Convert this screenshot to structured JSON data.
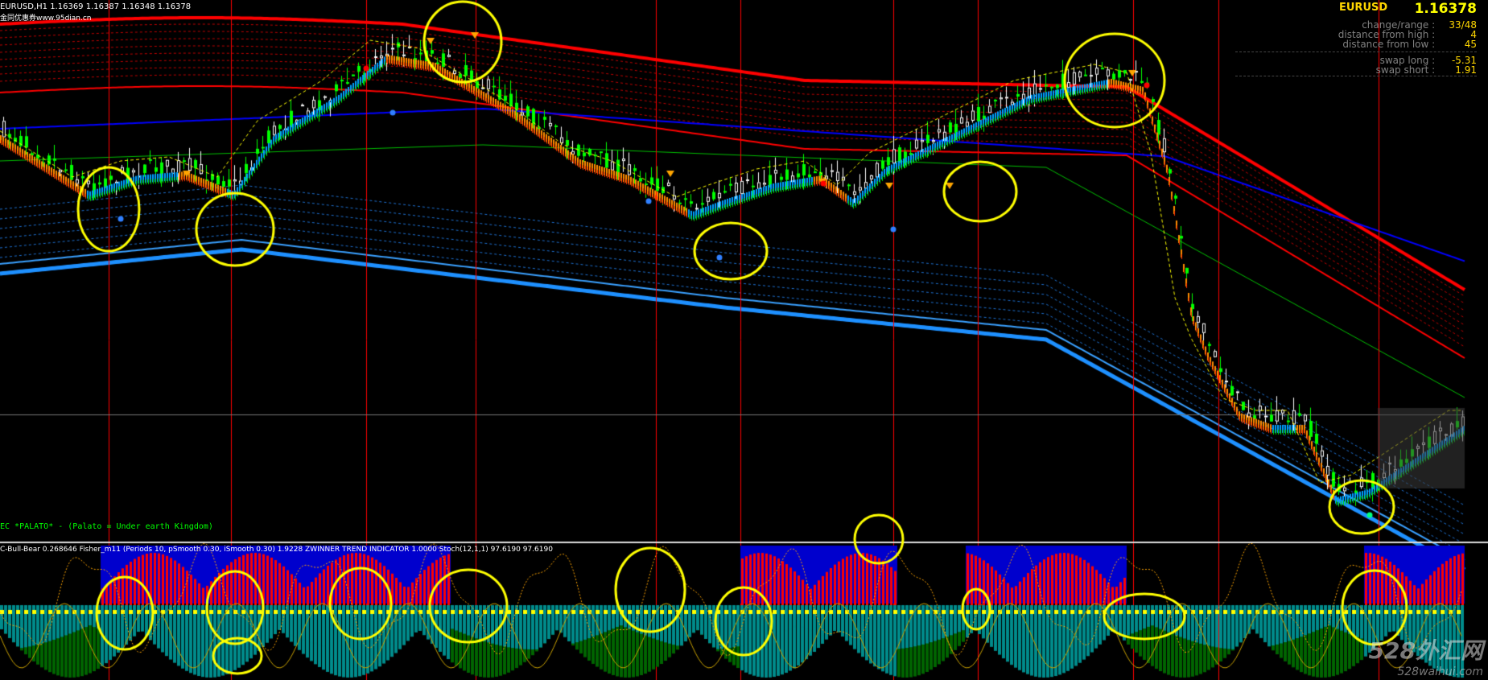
{
  "window": {
    "symbol_header": "EURUSD,H1  1.16369 1.16387 1.16348 1.16378",
    "source_watermark": "金同优惠券www.95dian.cn",
    "indicator_comment": "EC *PALATO* - (Palato = Under earth Kingdom)",
    "sub_window_header": "C-Bull-Bear 0.268646  Fisher_m11  (Periods 10, pSmooth 0.30, iSmooth 0.30)  1.9228  ZWINNER TREND INDICATOR 1.0000  Stoch(12,1,1) 97.6190 97.6190",
    "corner_watermark": "528外汇网",
    "corner_watermark_url": "528waihui.com"
  },
  "info_panel": {
    "symbol": "EURUSD",
    "price": "1.16378",
    "rows": [
      {
        "label": "change/range :",
        "value": "33/48"
      },
      {
        "label": "distance from high :",
        "value": "4"
      },
      {
        "label": "distance from low :",
        "value": "45"
      },
      {
        "label": "swap long :",
        "value": "-5.31"
      },
      {
        "label": "swap short :",
        "value": "1.91"
      }
    ]
  },
  "colors": {
    "background": "#000000",
    "bull_candle": "#00FF00",
    "bear_candle": "#FFFFFF",
    "upper_band": "#FF0000",
    "lower_band": "#1E90FF",
    "ma_blue": "#0000FF",
    "trend_orange": "#FF8C00",
    "signal_yellow": "#FFFF00",
    "session_line": "#FF0000",
    "histogram_blue": "#0000CD",
    "histogram_red": "#FF0000",
    "histogram_teal": "#008B8B",
    "histogram_green": "#006400",
    "annotation_circle": "#FFFF00"
  },
  "chart_data": {
    "type": "candlestick",
    "symbol": "EURUSD",
    "timeframe": "H1",
    "ohlc_last": {
      "open": 1.16369,
      "high": 1.16387,
      "low": 1.16348,
      "close": 1.16378
    },
    "close_series": [
      1.1712,
      1.1708,
      1.1703,
      1.1698,
      1.1695,
      1.1699,
      1.1702,
      1.1704,
      1.1701,
      1.1697,
      1.1694,
      1.1699,
      1.1707,
      1.1716,
      1.1724,
      1.1732,
      1.1738,
      1.1744,
      1.1748,
      1.1747,
      1.1743,
      1.1736,
      1.1728,
      1.1721,
      1.1715,
      1.1709,
      1.1704,
      1.1699,
      1.1695,
      1.1692,
      1.1695,
      1.1698,
      1.17,
      1.1701,
      1.1701,
      1.17,
      1.17,
      1.1701,
      1.1702,
      1.1707,
      1.1713,
      1.1718,
      1.1722,
      1.1723,
      1.1715,
      1.17,
      1.168,
      1.166,
      1.1645,
      1.1632,
      1.1627,
      1.1628,
      1.1624,
      1.1617,
      1.1615,
      1.1622,
      1.163,
      1.1636
    ],
    "sessions": 13,
    "annotations": "yellow hand-drawn circles around turning points"
  }
}
